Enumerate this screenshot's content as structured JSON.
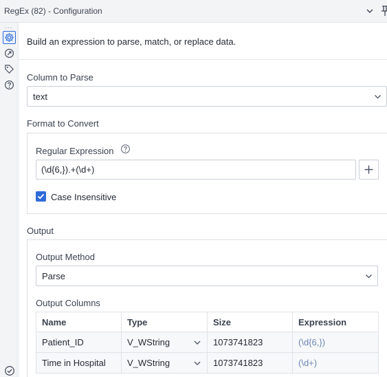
{
  "window": {
    "title": "RegEx (82) - Configuration"
  },
  "rail": {
    "dots": "...",
    "icons": [
      "gear-icon",
      "connection-icon",
      "tag-icon",
      "help-icon",
      "check-circle-icon"
    ]
  },
  "description": "Build an expression to parse, match, or replace data.",
  "column_to_parse": {
    "label": "Column to Parse",
    "value": "text"
  },
  "format": {
    "label": "Format to Convert",
    "regex_label": "Regular Expression",
    "regex_value": "(\\d{6,}).+(\\d+)",
    "case_insensitive_label": "Case Insensitive",
    "case_insensitive_checked": true
  },
  "output": {
    "label": "Output",
    "method_label": "Output Method",
    "method_value": "Parse",
    "columns_label": "Output Columns",
    "headers": [
      "Name",
      "Type",
      "Size",
      "Expression"
    ],
    "rows": [
      {
        "name": "Patient_ID",
        "type": "V_WString",
        "size": "1073741823",
        "expression": "(\\d{6,})"
      },
      {
        "name": "Time in Hospital",
        "type": "V_WString",
        "size": "1073741823",
        "expression": "(\\d+)"
      }
    ]
  },
  "colors": {
    "accent": "#2f6bd8",
    "border": "#c9ced6",
    "expression_text": "#6e88b5"
  }
}
